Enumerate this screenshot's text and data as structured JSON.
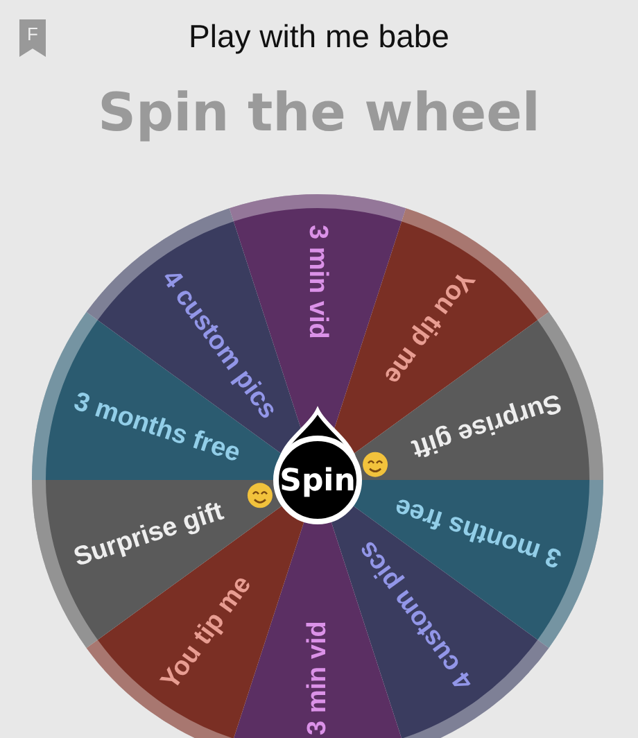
{
  "header": {
    "badge": "F",
    "title": "Play with me babe"
  },
  "heading": "Spin the wheel",
  "wheel": {
    "button": "Spin",
    "segments": [
      {
        "label": "3 min vid",
        "color": "#5b2f63",
        "emoji": false
      },
      {
        "label": "You tip me",
        "color": "#7a2f24",
        "emoji": false
      },
      {
        "label": "Surprise gift",
        "color": "#5a5a5a",
        "emoji": true
      },
      {
        "label": "3 months free",
        "color": "#2b5b70",
        "emoji": false
      },
      {
        "label": "4 custom pics",
        "color": "#3a3c5f",
        "emoji": false
      },
      {
        "label": "3 min vid",
        "color": "#5b2f63",
        "emoji": false
      },
      {
        "label": "You tip me",
        "color": "#7a2f24",
        "emoji": false
      },
      {
        "label": "Surprise gift",
        "color": "#5a5a5a",
        "emoji": true
      },
      {
        "label": "3 months free",
        "color": "#2b5b70",
        "emoji": false
      },
      {
        "label": "4 custom pics",
        "color": "#3a3c5f",
        "emoji": false
      }
    ]
  }
}
